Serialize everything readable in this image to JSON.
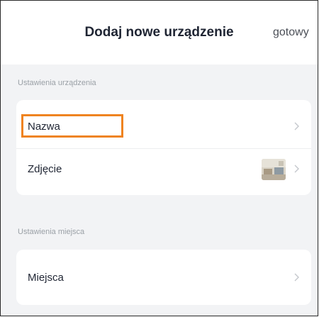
{
  "header": {
    "title": "Dodaj nowe urządzenie",
    "done_label": "gotowy"
  },
  "sections": [
    {
      "label": "Ustawienia urządzenia",
      "rows": [
        {
          "label": "Nazwa",
          "icon": "chevron-right-icon"
        },
        {
          "label": "Zdjęcie",
          "icon": "chevron-right-icon",
          "thumbnail": "room-photo"
        }
      ]
    },
    {
      "label": "Ustawienia miejsca",
      "rows": [
        {
          "label": "Miejsca",
          "icon": "chevron-right-icon"
        }
      ]
    }
  ],
  "colors": {
    "highlight": "#ef8320",
    "background": "#f2f3f5",
    "card": "#ffffff",
    "text": "#1f2533",
    "muted": "#9aa0a6"
  }
}
